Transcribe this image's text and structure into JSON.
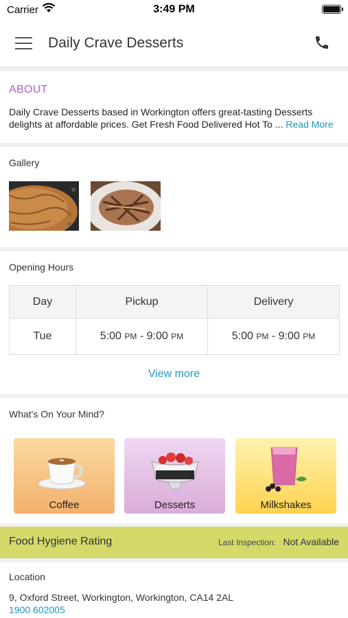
{
  "status_bar": {
    "carrier": "Carrier",
    "time": "3:49 PM"
  },
  "header": {
    "title": "Daily Crave Desserts",
    "menu_icon": "hamburger-menu-icon",
    "call_icon": "phone-icon"
  },
  "about": {
    "heading": "ABOUT",
    "text": "Daily Crave Desserts based in Workington offers great-tasting Desserts delights at affordable prices. Get Fresh Food Delivered Hot To ",
    "ellipsis": "...",
    "read_more": "Read More"
  },
  "gallery": {
    "label": "Gallery"
  },
  "opening_hours": {
    "label": "Opening Hours",
    "columns": [
      "Day",
      "Pickup",
      "Delivery"
    ],
    "rows": [
      {
        "day": "Tue",
        "pickup_start": "5:00",
        "pickup_start_ampm": "PM",
        "pickup_sep": " - ",
        "pickup_end": "9:00",
        "pickup_end_ampm": "PM",
        "delivery_start": "5:00",
        "delivery_start_ampm": "PM",
        "delivery_sep": " - ",
        "delivery_end": "9:00",
        "delivery_end_ampm": "PM"
      }
    ],
    "view_more": "View more"
  },
  "mind": {
    "label": "What's On Your Mind?",
    "categories": [
      {
        "label": "Coffee"
      },
      {
        "label": "Desserts"
      },
      {
        "label": "Milkshakes"
      }
    ]
  },
  "hygiene": {
    "title": "Food Hygiene Rating",
    "inspection_label": "Last Inspection:",
    "inspection_value": "Not Available"
  },
  "location": {
    "label": "Location",
    "address": "9, Oxford Street, Workington, Workington, CA14 2AL",
    "phone": "1900 602005"
  },
  "colors": {
    "accent_link": "#2196c4",
    "about_heading": "#b35fc7",
    "hygiene_bar": "#d4d96a"
  }
}
